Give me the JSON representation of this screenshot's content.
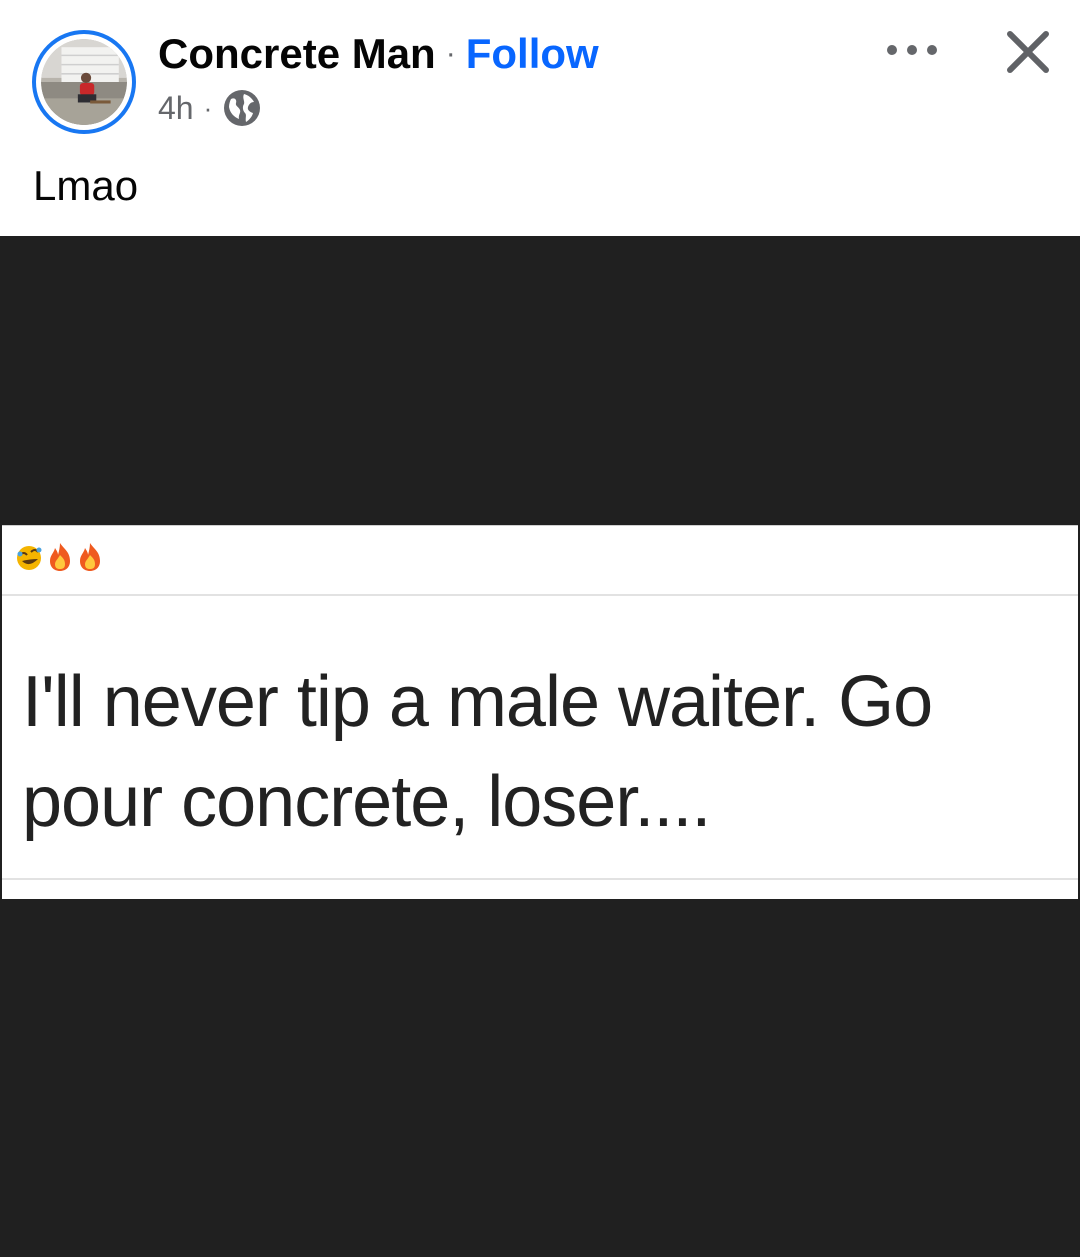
{
  "post": {
    "author_name": "Concrete Man",
    "separator": "·",
    "follow_label": "Follow",
    "timestamp": "4h",
    "meta_separator": "·",
    "privacy_icon": "globe-icon",
    "caption": "Lmao"
  },
  "header_actions": {
    "more_icon": "more-horizontal-icon",
    "close_icon": "close-icon"
  },
  "meme": {
    "reaction_emojis": [
      "rolling-laughing-emoji",
      "fire-emoji",
      "fire-emoji"
    ],
    "line1": "I'll never tip a male waiter. Go",
    "line2": "pour concrete, loser...."
  },
  "colors": {
    "follow_blue": "#0866ff",
    "avatar_ring": "#1877f2",
    "media_background": "#202020",
    "secondary_text": "#65676b"
  }
}
